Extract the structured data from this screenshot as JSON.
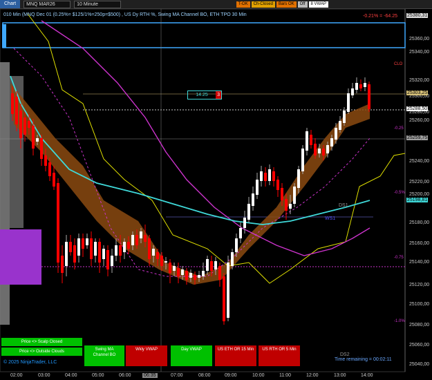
{
  "toolbar": {
    "chart_tab": "Chart",
    "instrument": "MNQ MAR26",
    "interval": "10 Minute",
    "buttons": [
      "T-OK",
      "Ch-Closed",
      "Bars OK",
      "Off",
      "8 VWAP"
    ]
  },
  "chart": {
    "title": "010 Min (MNQ Dec 01 (0.25%= $125/1%=250p=$500) , US Dy RTH %, Swing MA Channel BO, ETH TPO 30 Min",
    "pct_change": "-0.21% = -64.25",
    "close_label": "CLO",
    "position_qty": "14.25",
    "position_count": "3",
    "ds1": "DS1",
    "ws1": "WS1",
    "ds2": "DS2",
    "copyright": "© 2025 NinjaTrader, LLC",
    "time_remaining": "Time remaining = 00:02:11",
    "level_labels": [
      "-0.25",
      "-0.5%",
      "-0.75",
      "-1.0%"
    ]
  },
  "price_axis": {
    "ticks": [
      "25360,00",
      "25340,00",
      "25320,00",
      "25300,00",
      "25280,00",
      "25260,00",
      "25240,00",
      "25220,00",
      "25200,00",
      "25180,00",
      "25160,00",
      "25140,00",
      "25120,00",
      "25100,00",
      "25080,00",
      "25060,00",
      "25040,00"
    ],
    "tags": [
      {
        "text": "25380,31",
        "color": "#dddddd"
      },
      {
        "text": "25303,25",
        "color": "#d8c27a"
      },
      {
        "text": "25288,50",
        "color": "#ffffff"
      },
      {
        "text": "25259,75",
        "color": "#a0a0a0"
      },
      {
        "text": "25198,81",
        "color": "#3fd9d9"
      }
    ]
  },
  "time_axis": {
    "labels": [
      "02:00",
      "03:00",
      "04:00",
      "05:00",
      "06:00",
      "06:35",
      "07:00",
      "08:00",
      "09:00",
      "10:00",
      "11:00",
      "12:00",
      "13:00",
      "14:00"
    ]
  },
  "buttons": [
    {
      "label1": "Price <> Scalp Closed",
      "label2": "",
      "color": "#00c000"
    },
    {
      "label1": "Price <> Outside Clouds",
      "label2": "",
      "color": "#00c000"
    },
    {
      "label1": "Swing MA",
      "label2": "Channel BO",
      "color": "#00c000"
    },
    {
      "label1": "Wkly VWAP",
      "label2": "",
      "color": "#c00000"
    },
    {
      "label1": "Day VWAP",
      "label2": "",
      "color": "#00c000"
    },
    {
      "label1": "US ETH OR 15 Min",
      "label2": "",
      "color": "#c00000"
    },
    {
      "label1": "US RTH OR 5 Min",
      "label2": "",
      "color": "#c00000"
    }
  ],
  "colors": {
    "up": "#ffffff",
    "down": "#ff0000",
    "cyan_ma": "#3fd9d9",
    "magenta_ma": "#cc33cc",
    "yellow": "#e0e000",
    "cloud": "#8b4a10",
    "profile": "#9933cc"
  }
}
